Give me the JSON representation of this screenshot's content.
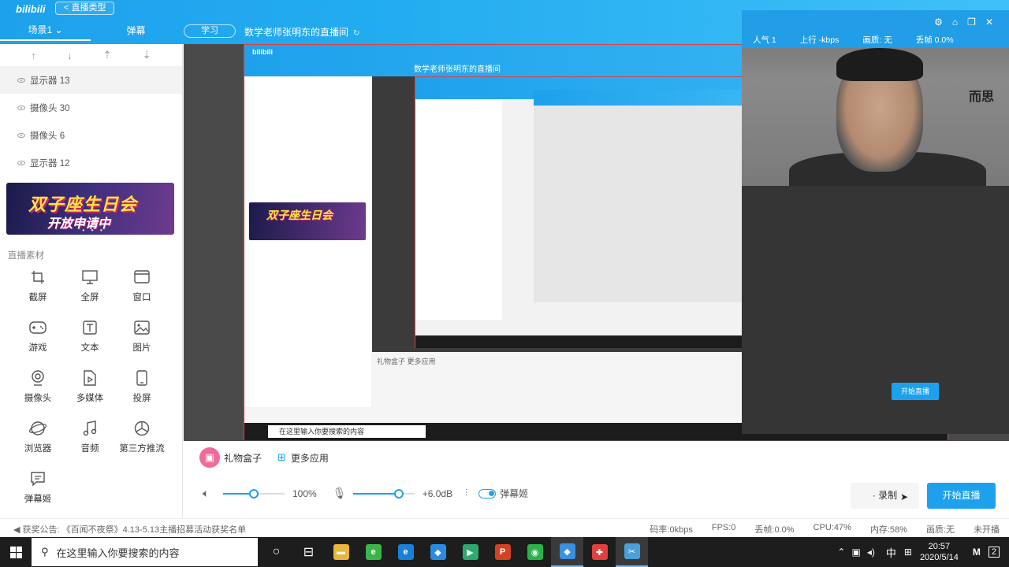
{
  "header": {
    "logo": "bilibili",
    "live_type_button": "< 直播类型",
    "scene_tab": "场景1",
    "danmu_tab": "弹幕",
    "study_tag": "学习",
    "room_title": "数学老师张明东的直播间"
  },
  "sidebar": {
    "sort_icons": [
      "↑",
      "↓",
      "⇡",
      "⇣"
    ],
    "sources": [
      {
        "label": "显示器 13",
        "selected": true
      },
      {
        "label": "摄像头 30",
        "selected": false
      },
      {
        "label": "摄像头 6",
        "selected": false
      },
      {
        "label": "显示器 12",
        "selected": false
      }
    ],
    "banner": {
      "line1": "双子座生日会",
      "line2": "开放申请中"
    },
    "materials_title": "直播素材",
    "materials": [
      {
        "label": "截屏",
        "icon": "crop-icon"
      },
      {
        "label": "全屏",
        "icon": "monitor-icon"
      },
      {
        "label": "窗口",
        "icon": "window-icon"
      },
      {
        "label": "游戏",
        "icon": "gamepad-icon"
      },
      {
        "label": "文本",
        "icon": "text-icon"
      },
      {
        "label": "图片",
        "icon": "image-icon"
      },
      {
        "label": "摄像头",
        "icon": "webcam-icon"
      },
      {
        "label": "多媒体",
        "icon": "media-icon"
      },
      {
        "label": "投屏",
        "icon": "phone-icon"
      },
      {
        "label": "浏览器",
        "icon": "browser-icon"
      },
      {
        "label": "音频",
        "icon": "music-icon"
      },
      {
        "label": "第三方推流",
        "icon": "stream-icon"
      },
      {
        "label": "弹幕姬",
        "icon": "chat-icon"
      }
    ]
  },
  "webcam": {
    "stats": [
      "人气 1",
      "上行 -kbps",
      "画质: 无",
      "丢帧 0.0%"
    ],
    "wall_text": "而思"
  },
  "nested": {
    "search_text": "在这里输入你要搜索的内容",
    "gift_text": "礼物盒子   更多应用",
    "start_btn": "开始直播"
  },
  "controls": {
    "gift_label": "礼物盒子",
    "more_apps_label": "更多应用",
    "volume_percent": "100%",
    "volume_level": 0.5,
    "mic_db": "+6.0dB",
    "mic_level": 0.75,
    "danmu_toggle_label": "弹幕姬",
    "record_button": "· 录制",
    "start_button": "开始直播"
  },
  "status": {
    "announcement": "◀ 获奖公告: 《百闻不夜祭》4.13-5.13主播招募活动获奖名单",
    "bitrate": "码率:0kbps",
    "fps": "FPS:0",
    "dropped": "丢帧:0.0%",
    "cpu": "CPU:47%",
    "memory": "内存:58%",
    "quality": "画质:无",
    "live_state": "未开播"
  },
  "taskbar": {
    "search_placeholder": "在这里输入你要搜索的内容",
    "apps": [
      {
        "name": "cortana",
        "glyph": "○",
        "color": "transparent",
        "active": false
      },
      {
        "name": "task-view",
        "glyph": "⊟",
        "color": "transparent",
        "active": false
      },
      {
        "name": "file-explorer",
        "glyph": "▬",
        "color": "#e8b63a",
        "active": false
      },
      {
        "name": "360-browser",
        "glyph": "e",
        "color": "#3bb54a",
        "active": false
      },
      {
        "name": "edge",
        "glyph": "e",
        "color": "#1b7fd6",
        "active": false
      },
      {
        "name": "feishu",
        "glyph": "◆",
        "color": "#2a8be0",
        "active": false
      },
      {
        "name": "play",
        "glyph": "▶",
        "color": "#2ea96e",
        "active": false
      },
      {
        "name": "powerpoint",
        "glyph": "P",
        "color": "#d04423",
        "active": false
      },
      {
        "name": "wechat",
        "glyph": "◉",
        "color": "#2bb24c",
        "active": false
      },
      {
        "name": "bilibili-live",
        "glyph": "◆",
        "color": "#3a8fde",
        "active": true
      },
      {
        "name": "paint",
        "glyph": "✚",
        "color": "#e24040",
        "active": false
      },
      {
        "name": "snip",
        "glyph": "✂",
        "color": "#4aa0d8",
        "active": true
      }
    ],
    "ime": "中",
    "time": "20:57",
    "date": "2020/5/14",
    "notifications": "2"
  }
}
